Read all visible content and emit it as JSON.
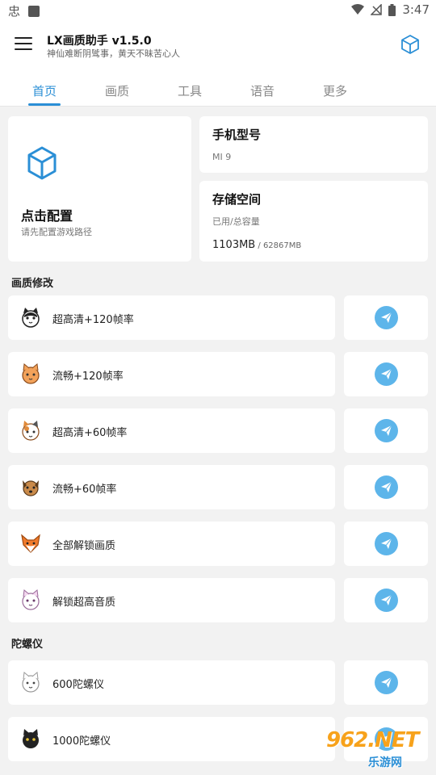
{
  "status_bar": {
    "left_glyph": "忠",
    "time": "3:47"
  },
  "app": {
    "title": "LX画质助手 v1.5.0",
    "subtitle": "神仙难断阴骘事，黄天不昧苦心人"
  },
  "tabs": [
    {
      "label": "首页",
      "active": true
    },
    {
      "label": "画质"
    },
    {
      "label": "工具"
    },
    {
      "label": "语音"
    },
    {
      "label": "更多"
    }
  ],
  "config_card": {
    "title": "点击配置",
    "subtitle": "请先配置游戏路径",
    "icon": "cube-icon"
  },
  "phone_model": {
    "title": "手机型号",
    "value": "MI 9"
  },
  "storage": {
    "title": "存储空间",
    "subtitle": "已用/总容量",
    "used": "1103MB",
    "total": " / 62867MB"
  },
  "sections": {
    "quality": {
      "title": "画质修改",
      "items": [
        {
          "label": "超高清+120帧率",
          "icon": "black-white-cat-icon"
        },
        {
          "label": "流畅+120帧率",
          "icon": "orange-cat-icon"
        },
        {
          "label": "超高清+60帧率",
          "icon": "calico-cat-icon"
        },
        {
          "label": "流畅+60帧率",
          "icon": "brown-dog-icon"
        },
        {
          "label": "全部解锁画质",
          "icon": "fox-icon"
        },
        {
          "label": "解锁超高音质",
          "icon": "white-cat-icon"
        }
      ]
    },
    "gyro": {
      "title": "陀螺仪",
      "items": [
        {
          "label": "600陀螺仪",
          "icon": "white-cat-face-icon"
        },
        {
          "label": "1000陀螺仪",
          "icon": "black-cat-icon"
        }
      ]
    }
  },
  "watermark": {
    "brand": "962.NET",
    "text": "乐游网"
  },
  "colors": {
    "accent": "#2b8fd6",
    "send_button": "#5db5ea",
    "background": "#f2f2f2"
  }
}
